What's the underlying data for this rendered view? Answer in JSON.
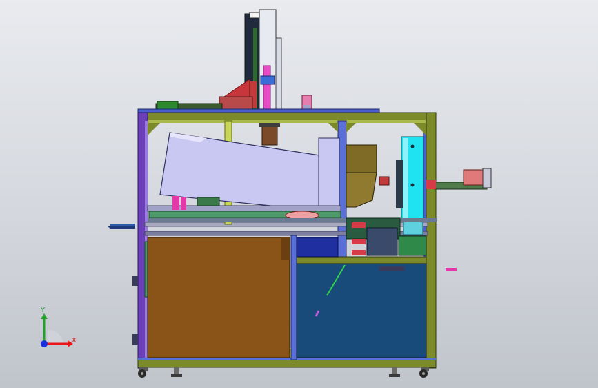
{
  "viewport": {
    "background_top": "#e9ebef",
    "background_bottom": "#c0c4cb"
  },
  "colors": {
    "frame_olive": "#7d8a2a",
    "frame_blue": "#5a6fd8",
    "frame_purple": "#6a3fb8",
    "brown_panel": "#8a5418",
    "blue_panel": "#184a7a",
    "hopper_lavender": "#c9c8f2",
    "hopper_olive": "#7f6a26",
    "cyan_column": "#1fe3f0",
    "control_box": "#4f9a6a",
    "magenta_parts": "#e23aa8",
    "red_parts": "#d83b48"
  },
  "parts": {
    "vertical_lift": "vertical-lift-axis",
    "cyan_column": "cyan-guide-column",
    "hopper": "inclined-hopper",
    "feed_tray": "olive-feed-tray",
    "conveyor": "horizontal-conveyor",
    "motor": "right-drive-motor",
    "control_box": "side-control-box",
    "lower_left": "lower-left-cabinet-panel",
    "lower_right": "lower-right-cabinet-panel",
    "casters": "caster-wheel"
  },
  "triad": {
    "x_label": "X",
    "y_label": "Y",
    "x_color": "#e8181a",
    "y_color": "#22a02a",
    "z_color": "#1830e0"
  }
}
